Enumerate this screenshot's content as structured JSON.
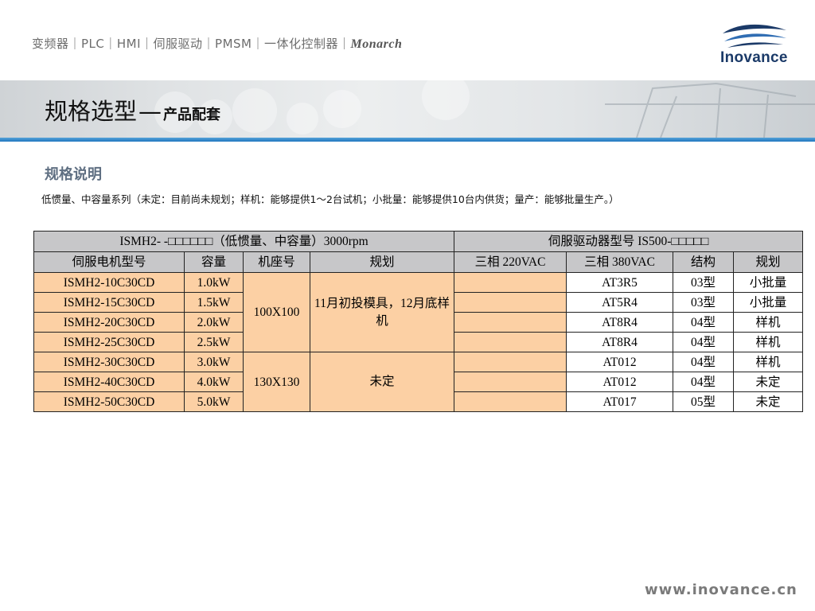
{
  "header": {
    "product_line": "变频器｜PLC｜HMI｜伺服驱动｜PMSM｜一体化控制器｜",
    "monarch_logo_text": "Monarch",
    "brand": "Inovance"
  },
  "banner": {
    "title_main": "规格选型",
    "title_dash": "—",
    "title_sub": "产品配套"
  },
  "section_title": "规格说明",
  "note": "低惯量、中容量系列（未定：目前尚未规划；样机：能够提供1～2台试机；小批量：能够提供10台内供货；量产：能够批量生产。）",
  "table": {
    "group_left": "ISMH2- -□□□□□□（低惯量、中容量）3000rpm",
    "group_right": "伺服驱动器型号 IS500-□□□□□",
    "columns": [
      "伺服电机型号",
      "容量",
      "机座号",
      "规划",
      "三相 220VAC",
      "三相 380VAC",
      "结构",
      "规划"
    ],
    "frame_groups": [
      {
        "frame": "100X100",
        "plan": "11月初投模具，12月底样机"
      },
      {
        "frame": "130X130",
        "plan": "未定"
      }
    ],
    "rows": [
      {
        "model": "ISMH2-10C30CD",
        "capacity": "1.0kW",
        "ac220": "",
        "ac380": "AT3R5",
        "structure": "03型",
        "status": "小批量"
      },
      {
        "model": "ISMH2-15C30CD",
        "capacity": "1.5kW",
        "ac220": "",
        "ac380": "AT5R4",
        "structure": "03型",
        "status": "小批量"
      },
      {
        "model": "ISMH2-20C30CD",
        "capacity": "2.0kW",
        "ac220": "",
        "ac380": "AT8R4",
        "structure": "04型",
        "status": "样机"
      },
      {
        "model": "ISMH2-25C30CD",
        "capacity": "2.5kW",
        "ac220": "",
        "ac380": "AT8R4",
        "structure": "04型",
        "status": "样机"
      },
      {
        "model": "ISMH2-30C30CD",
        "capacity": "3.0kW",
        "ac220": "",
        "ac380": "AT012",
        "structure": "04型",
        "status": "样机"
      },
      {
        "model": "ISMH2-40C30CD",
        "capacity": "4.0kW",
        "ac220": "",
        "ac380": "AT012",
        "structure": "04型",
        "status": "未定"
      },
      {
        "model": "ISMH2-50C30CD",
        "capacity": "5.0kW",
        "ac220": "",
        "ac380": "AT017",
        "structure": "05型",
        "status": "未定"
      }
    ]
  },
  "footer_url": "www.inovance.cn",
  "colors": {
    "header_gray": "#c7c7c9",
    "peach": "#fcd0a4",
    "accent_blue": "#1f77c0",
    "brand_navy": "#1b3a68"
  }
}
